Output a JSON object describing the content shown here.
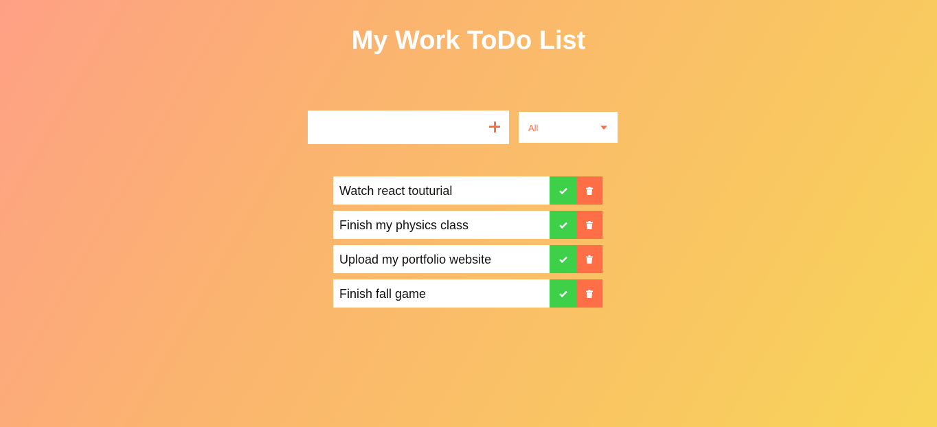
{
  "header": {
    "title": "My Work ToDo List"
  },
  "new_todo": {
    "value": "",
    "add_icon": "plus-icon"
  },
  "filter": {
    "selected": "All",
    "icon": "chevron-down-icon"
  },
  "todos": [
    {
      "text": "Watch react touturial"
    },
    {
      "text": "Finish my physics class"
    },
    {
      "text": "Upload my portfolio website"
    },
    {
      "text": "Finish fall game"
    }
  ],
  "colors": {
    "accent": "#ff6f47",
    "complete": "#3fd04a",
    "title_text": "#ffffff"
  },
  "icons": {
    "complete": "check-icon",
    "delete": "trash-icon"
  }
}
